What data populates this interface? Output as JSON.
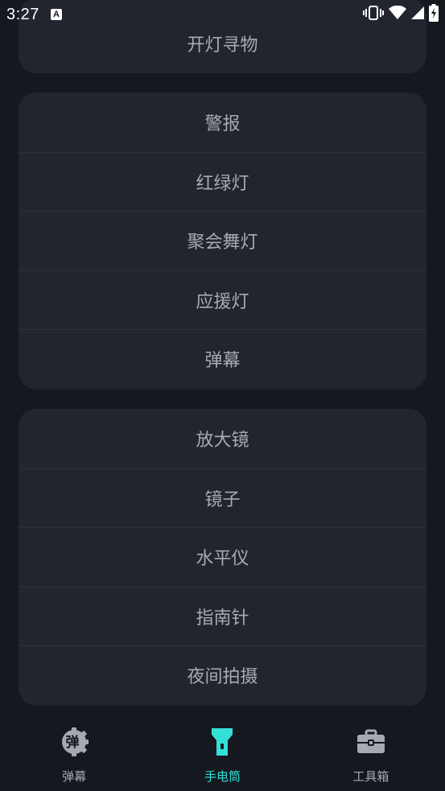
{
  "status_bar": {
    "time": "3:27",
    "notification_icon_letter": "A",
    "icons": [
      "text-notification-icon",
      "vibrate-icon",
      "wifi-icon",
      "signal-icon",
      "battery-charging-icon"
    ]
  },
  "groups": [
    {
      "items": [
        "开灯寻物"
      ]
    },
    {
      "items": [
        "警报",
        "红绿灯",
        "聚会舞灯",
        "应援灯",
        "弹幕"
      ]
    },
    {
      "items": [
        "放大镜",
        "镜子",
        "水平仪",
        "指南针",
        "夜间拍摄"
      ]
    }
  ],
  "tabs": [
    {
      "label": "弹幕",
      "icon": "barrage-gear-icon",
      "icon_text": "弹",
      "active": false
    },
    {
      "label": "手电筒",
      "icon": "flashlight-icon",
      "active": true
    },
    {
      "label": "工具箱",
      "icon": "toolbox-icon",
      "active": false
    }
  ],
  "colors": {
    "background": "#15181f",
    "card": "#22252e",
    "divider": "#2c3039",
    "text": "#a7aab1",
    "accent": "#33e0d6",
    "status_text": "#ffffff"
  }
}
